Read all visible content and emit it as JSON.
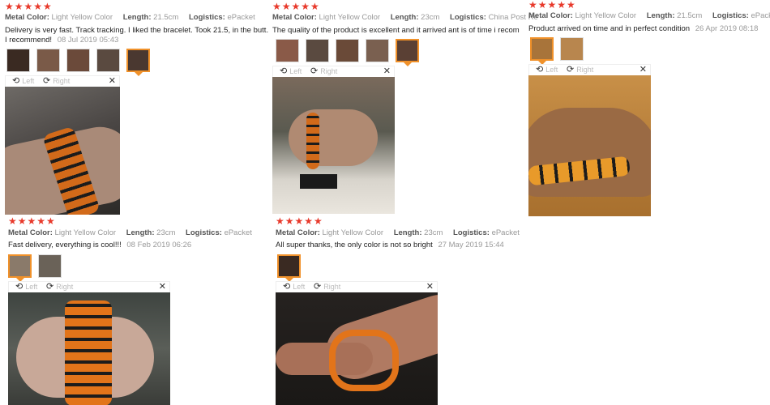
{
  "labels": {
    "metal_color": "Metal Color:",
    "length": "Length:",
    "logistics": "Logistics:",
    "left": "Left",
    "right": "Right"
  },
  "colors": {
    "star": "#e8392b",
    "selected_border": "#f0912a",
    "band_orange": "#e2741a"
  },
  "reviews": [
    {
      "stars": "★★★★★",
      "metal_color": "Light Yellow Color",
      "length": "21.5cm",
      "logistics": "ePacket",
      "text": "Delivery is very fast. Track tracking. I liked the bracelet. Took 21.5, in the butt. I recommend!",
      "date": "08 Jul 2019 05:43",
      "thumb_count": 5,
      "selected_thumb": 5
    },
    {
      "stars": "★★★★★",
      "metal_color": "Light Yellow Color",
      "length": "23cm",
      "logistics": "China Post Re",
      "text": "The quality of the product is excellent and it arrived ant is of time i recom",
      "date": "",
      "thumb_count": 5,
      "selected_thumb": 5
    },
    {
      "stars": "★★★★★",
      "metal_color": "Light Yellow Color",
      "length": "21.5cm",
      "logistics": "ePacket",
      "text": "Product arrived on time and in perfect condition",
      "date": "26 Apr 2019 08:18",
      "thumb_count": 2,
      "selected_thumb": 1
    },
    {
      "stars": "★★★★★",
      "metal_color": "Light Yellow Color",
      "length": "23cm",
      "logistics": "ePacket",
      "text": "Fast delivery, everything is cool!!!",
      "date": "08 Feb 2019 06:26",
      "thumb_count": 2,
      "selected_thumb": 1
    },
    {
      "stars": "★★★★★",
      "metal_color": "Light Yellow Color",
      "length": "23cm",
      "logistics": "ePacket",
      "text": "All super thanks, the only color is not so bright",
      "date": "27 May 2019 15:44",
      "thumb_count": 1,
      "selected_thumb": 1
    }
  ]
}
